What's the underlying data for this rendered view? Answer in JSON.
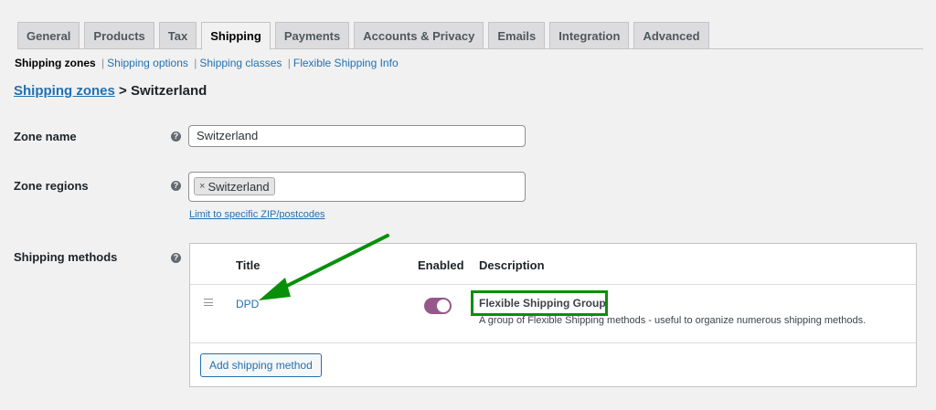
{
  "tabs": [
    {
      "label": "General"
    },
    {
      "label": "Products"
    },
    {
      "label": "Tax"
    },
    {
      "label": "Shipping",
      "active": true
    },
    {
      "label": "Payments"
    },
    {
      "label": "Accounts & Privacy"
    },
    {
      "label": "Emails"
    },
    {
      "label": "Integration"
    },
    {
      "label": "Advanced"
    }
  ],
  "subnav": {
    "current": "Shipping zones",
    "links": [
      "Shipping options",
      "Shipping classes",
      "Flexible Shipping Info"
    ],
    "separator": "|"
  },
  "heading": {
    "link": "Shipping zones",
    "suffix": " > Switzerland"
  },
  "zone_name": {
    "label": "Zone name",
    "value": "Switzerland"
  },
  "zone_regions": {
    "label": "Zone regions",
    "chips": [
      "Switzerland"
    ],
    "remove_glyph": "×",
    "limit_link": "Limit to specific ZIP/postcodes"
  },
  "help_glyph": "?",
  "shipping_methods": {
    "label": "Shipping methods",
    "columns": {
      "title": "Title",
      "enabled": "Enabled",
      "description": "Description"
    },
    "rows": [
      {
        "title": "DPD",
        "enabled": true,
        "description_title": "Flexible Shipping Group",
        "description_text": "A group of Flexible Shipping methods - useful to organize numerous shipping methods."
      }
    ],
    "add_button": "Add shipping method"
  },
  "colors": {
    "link": "#2271b1",
    "toggle_on": "#96588a",
    "annotation": "#0a8f0a"
  }
}
